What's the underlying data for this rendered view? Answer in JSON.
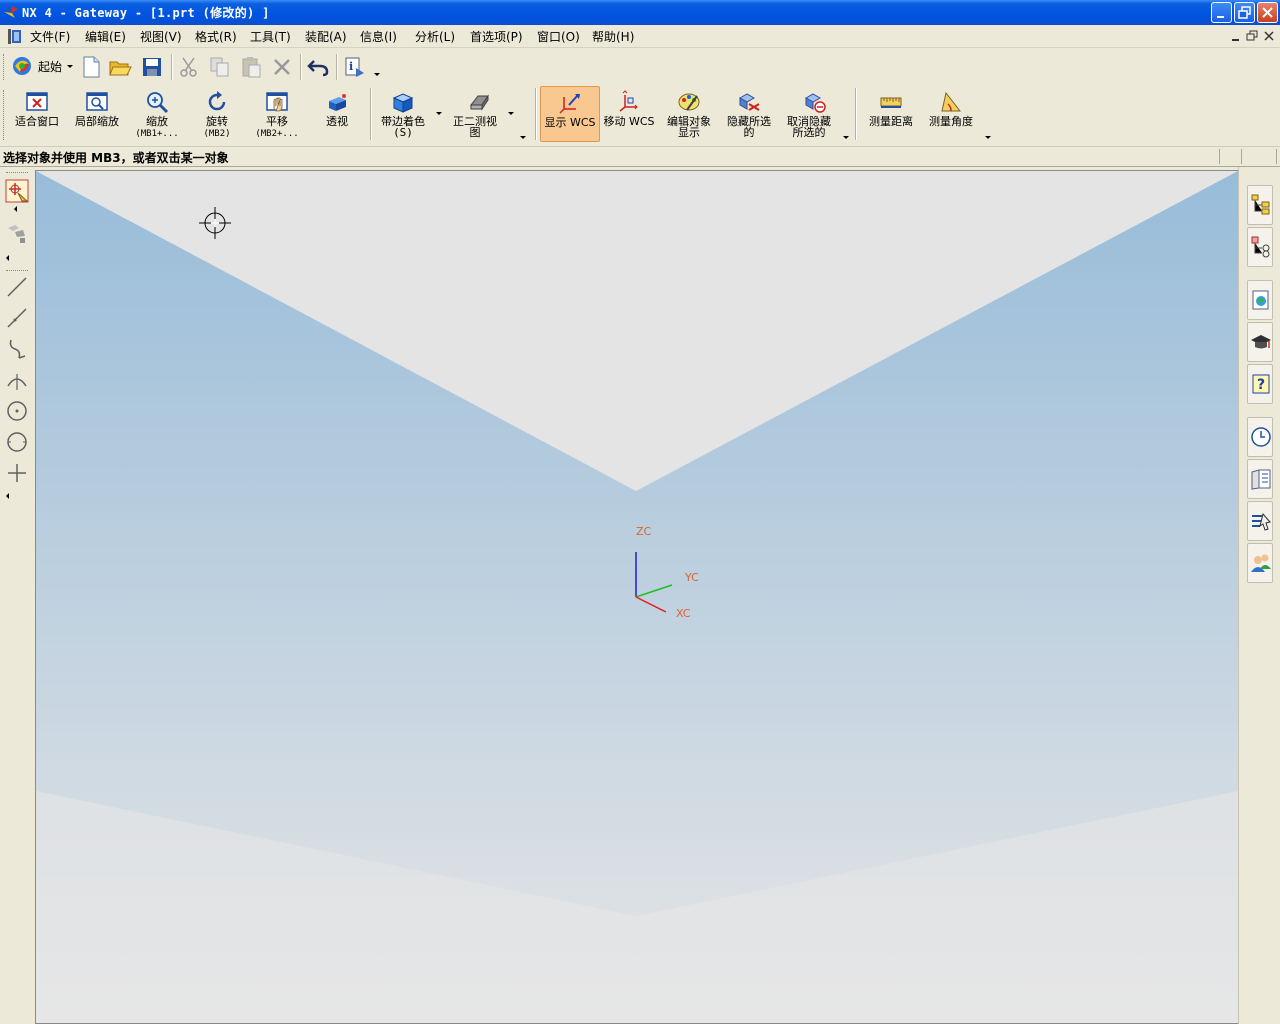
{
  "window": {
    "title": "NX 4 - Gateway - [1.prt  (修改的) ]",
    "accent": "#0053e1"
  },
  "menu": {
    "items": [
      {
        "label": "文件(F)"
      },
      {
        "label": "编辑(E)"
      },
      {
        "label": "视图(V)"
      },
      {
        "label": "格式(R)"
      },
      {
        "label": "工具(T)"
      },
      {
        "label": "装配(A)"
      },
      {
        "label": "信息(I)"
      },
      {
        "label": "分析(L)"
      },
      {
        "label": "首选项(P)"
      },
      {
        "label": "窗口(O)"
      },
      {
        "label": "帮助(H)"
      }
    ]
  },
  "standard_toolbar": {
    "start_label": "起始",
    "icons": [
      "start-icon",
      "new-icon",
      "open-icon",
      "save-icon",
      "cut-icon",
      "copy-icon",
      "paste-icon",
      "delete-icon",
      "undo-icon",
      "info-icon"
    ]
  },
  "view_toolbar": {
    "buttons": [
      {
        "label": "适合窗口",
        "sub": "",
        "icon": "fit-window-icon"
      },
      {
        "label": "局部缩放",
        "sub": "",
        "icon": "zoom-area-icon"
      },
      {
        "label": "缩放",
        "sub": "(MB1+...",
        "icon": "zoom-icon"
      },
      {
        "label": "旋转",
        "sub": "(MB2)",
        "icon": "rotate-icon"
      },
      {
        "label": "平移",
        "sub": "(MB2+...",
        "icon": "pan-icon"
      },
      {
        "label": "透视",
        "sub": "",
        "icon": "perspective-icon"
      },
      {
        "label": "带边着色",
        "sub": "(S)",
        "icon": "shaded-edges-icon"
      },
      {
        "label": "正二测视",
        "sub": "图",
        "icon": "dimetric-view-icon"
      },
      {
        "label": "显示 WCS",
        "sub": "",
        "icon": "display-wcs-icon"
      },
      {
        "label": "移动 WCS",
        "sub": "",
        "icon": "move-wcs-icon"
      },
      {
        "label": "编辑对象",
        "sub": "显示",
        "icon": "edit-object-display-icon"
      },
      {
        "label": "隐藏所选",
        "sub": "的",
        "icon": "hide-selected-icon"
      },
      {
        "label": "取消隐藏",
        "sub": "所选的",
        "icon": "unhide-selected-icon"
      },
      {
        "label": "测量距离",
        "sub": "",
        "icon": "measure-distance-icon"
      },
      {
        "label": "测量角度",
        "sub": "",
        "icon": "measure-angle-icon"
      }
    ]
  },
  "cue_line": {
    "text": "选择对象并使用 MB3，或者双击某一对象"
  },
  "wcs": {
    "zc": "ZC",
    "yc": "YC",
    "xc": "XC",
    "colors": {
      "x": "#e02020",
      "y": "#20c020",
      "z": "#2020d0",
      "label": "#e06030"
    }
  },
  "graphics": {
    "background_top": "#98bcd9",
    "background_bottom": "#e6e6e6"
  }
}
